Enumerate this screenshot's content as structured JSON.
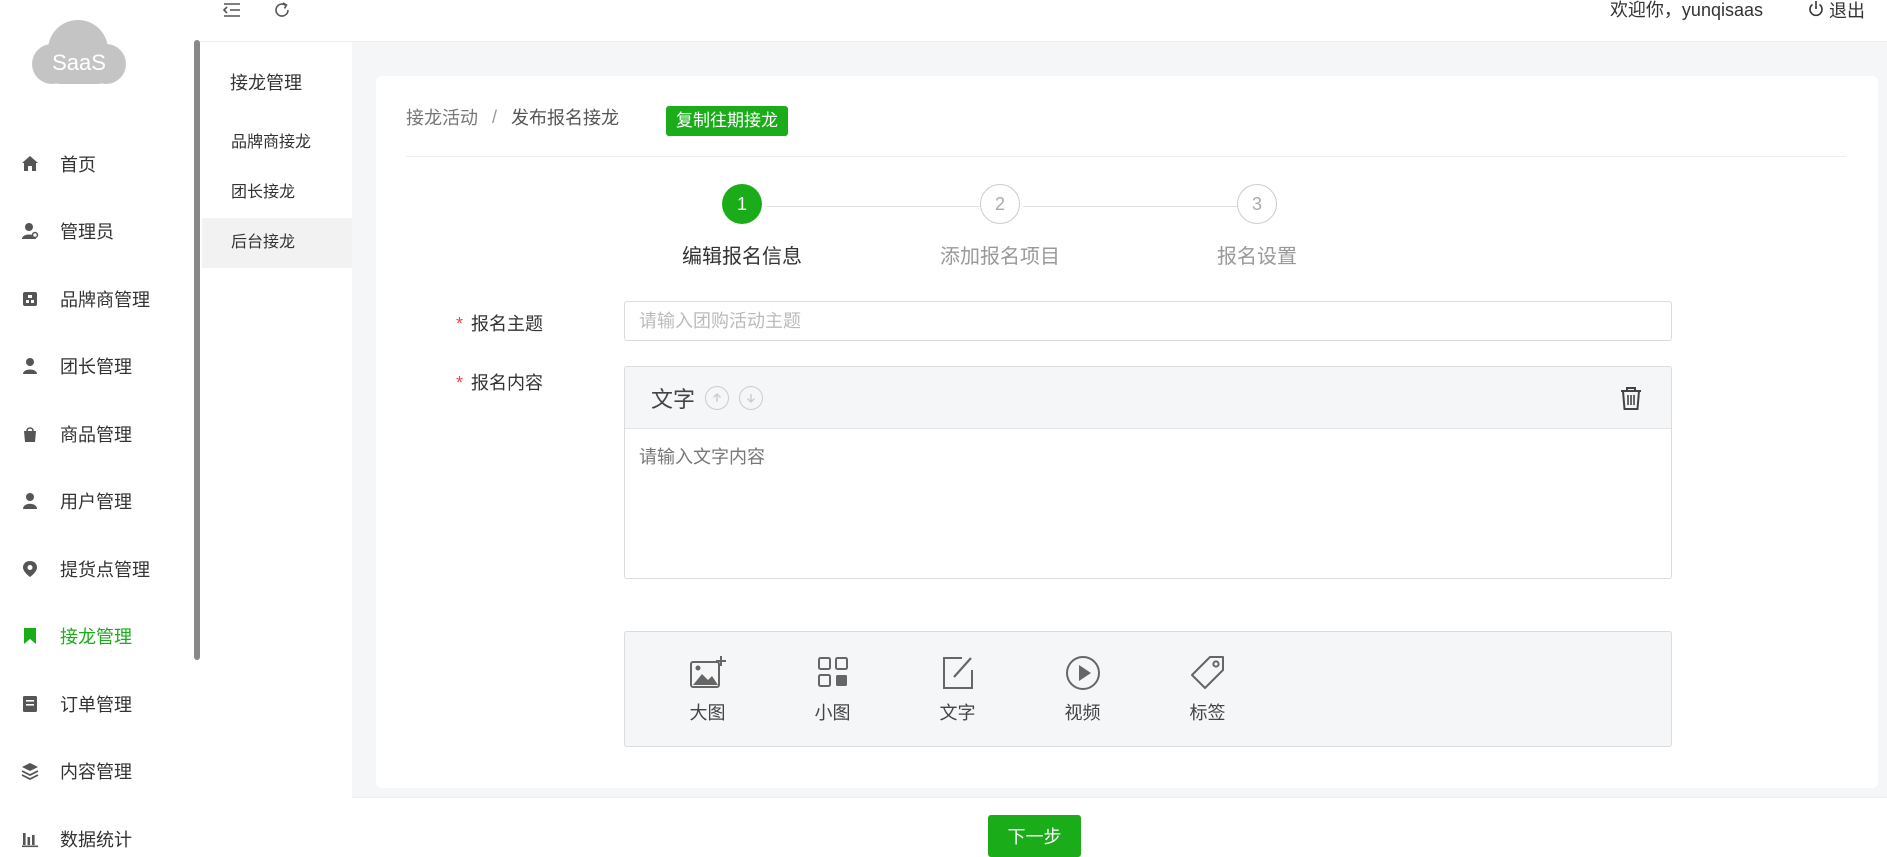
{
  "header": {
    "welcome": "欢迎你，yunqisaas",
    "logout_label": "退出"
  },
  "logo": {
    "text": "SaaS"
  },
  "sidebar": {
    "items": [
      {
        "label": "首页",
        "icon": "home-icon"
      },
      {
        "label": "管理员",
        "icon": "admin-user-icon"
      },
      {
        "label": "品牌商管理",
        "icon": "brand-icon"
      },
      {
        "label": "团长管理",
        "icon": "leader-icon"
      },
      {
        "label": "商品管理",
        "icon": "bag-icon"
      },
      {
        "label": "用户管理",
        "icon": "user-icon"
      },
      {
        "label": "提货点管理",
        "icon": "location-pin-icon"
      },
      {
        "label": "接龙管理",
        "icon": "bookmark-icon",
        "active": true
      },
      {
        "label": "订单管理",
        "icon": "order-icon"
      },
      {
        "label": "内容管理",
        "icon": "layers-icon"
      },
      {
        "label": "数据统计",
        "icon": "bar-chart-icon"
      }
    ]
  },
  "subsidebar": {
    "title": "接龙管理",
    "items": [
      {
        "label": "品牌商接龙"
      },
      {
        "label": "团长接龙"
      },
      {
        "label": "后台接龙",
        "active": true
      }
    ]
  },
  "breadcrumb": {
    "parent": "接龙活动",
    "separator": "/",
    "current": "发布报名接龙"
  },
  "copy_button": "复制往期接龙",
  "steps": [
    {
      "number": "1",
      "label": "编辑报名信息",
      "status": "done"
    },
    {
      "number": "2",
      "label": "添加报名项目",
      "status": "todo"
    },
    {
      "number": "3",
      "label": "报名设置",
      "status": "todo"
    }
  ],
  "form": {
    "required_mark": "*",
    "subject_label": "报名主题",
    "subject_placeholder": "请输入团购活动主题",
    "subject_value": "",
    "content_label": "报名内容",
    "content_block_title": "文字",
    "content_placeholder": "请输入文字内容"
  },
  "tools": [
    {
      "label": "大图",
      "icon": "large-image-icon"
    },
    {
      "label": "小图",
      "icon": "grid-image-icon"
    },
    {
      "label": "文字",
      "icon": "edit-text-icon"
    },
    {
      "label": "视频",
      "icon": "video-play-icon"
    },
    {
      "label": "标签",
      "icon": "tag-icon"
    }
  ],
  "next_button": "下一步",
  "colors": {
    "accent": "#1aad19",
    "required": "#e44444"
  }
}
